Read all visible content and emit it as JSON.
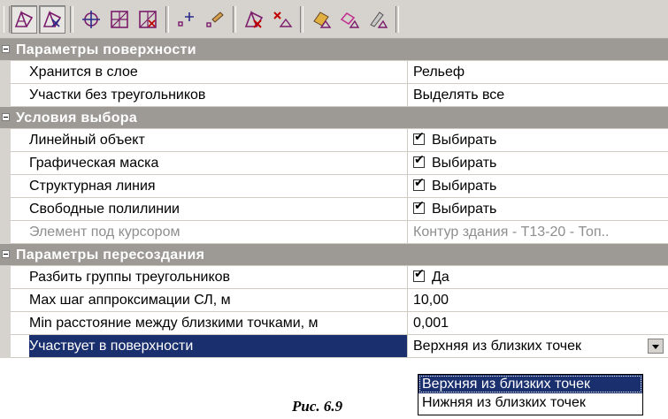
{
  "toolbar": {
    "buttons": [
      {
        "icon": "surface-triangles-icon",
        "pressed": true
      },
      {
        "icon": "surface-edit-icon",
        "pressed": true
      },
      {
        "icon": "move-point-icon",
        "pressed": false
      },
      {
        "icon": "grid-add-icon",
        "pressed": false
      },
      {
        "icon": "grid-remove-icon",
        "pressed": false
      },
      {
        "icon": "add-point-icon",
        "pressed": false
      },
      {
        "icon": "brush-icon",
        "pressed": false
      },
      {
        "icon": "delete-triangles-icon",
        "pressed": false
      },
      {
        "icon": "delete-point-icon",
        "pressed": false
      },
      {
        "icon": "layer-color-icon",
        "pressed": false
      },
      {
        "icon": "layer-erase-icon",
        "pressed": false
      },
      {
        "icon": "layer-style-icon",
        "pressed": false
      }
    ]
  },
  "sections": {
    "surface": {
      "title": "Параметры поверхности",
      "rows": [
        {
          "name": "Хранится в слое",
          "value": "Рельеф"
        },
        {
          "name": "Участки без треугольников",
          "value": "Выделять все"
        }
      ]
    },
    "selection": {
      "title": "Условия выбора",
      "rows": [
        {
          "name": "Линейный объект",
          "value": "Выбирать",
          "checked": true
        },
        {
          "name": "Графическая маска",
          "value": "Выбирать",
          "checked": true
        },
        {
          "name": "Структурная линия",
          "value": "Выбирать",
          "checked": true
        },
        {
          "name": "Свободные полилинии",
          "value": "Выбирать",
          "checked": true
        },
        {
          "name": "Элемент под курсором",
          "value": "Контур здания - Т13-20 - Топ..",
          "disabled": true
        }
      ]
    },
    "rebuild": {
      "title": "Параметры пересоздания",
      "rows": [
        {
          "name": "Разбить группы треугольников",
          "value": "Да",
          "checked": true
        },
        {
          "name": "Max шаг аппроксимации СЛ, м",
          "value": "10,00"
        },
        {
          "name": "Min расстояние между близкими точками, м",
          "value": "0,001"
        },
        {
          "name": "Участвует в поверхности",
          "value": "Верхняя из близких точек",
          "selected": true
        }
      ]
    }
  },
  "dropdown": {
    "options": [
      "Верхняя из близких точек",
      "Нижняя из близких точек"
    ],
    "highlighted": "Верхняя из близких точек"
  },
  "caption": "Рис. 6.9",
  "colors": {
    "category_bg": "#9d9a96",
    "selection_bg": "#1a2f6e",
    "toolbar_bg": "#d6d3ce"
  }
}
